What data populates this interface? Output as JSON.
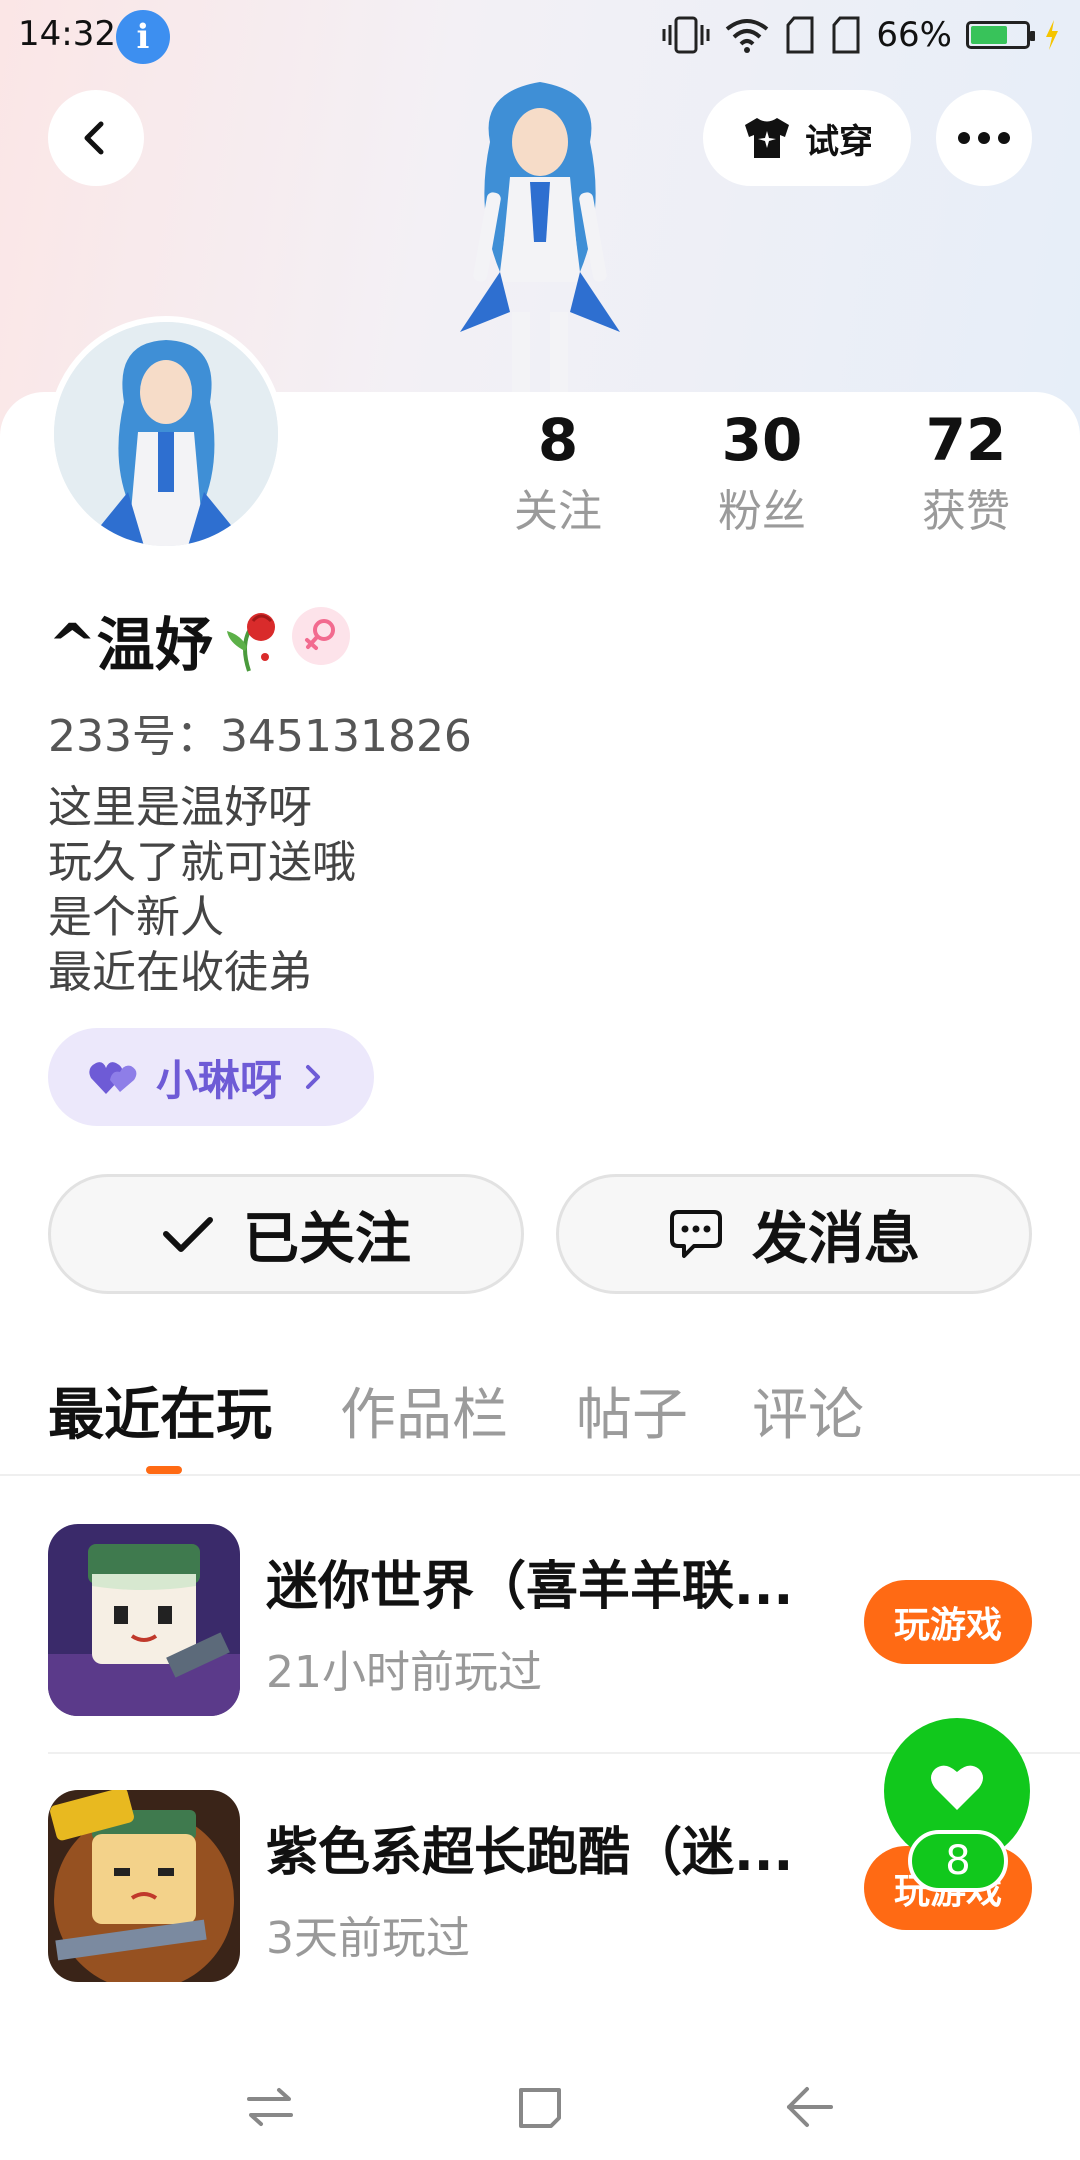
{
  "status_bar": {
    "time": "14:32",
    "battery_percent": "66%",
    "battery_level": 0.66,
    "icons": [
      "info-icon",
      "vibrate-icon",
      "wifi-icon",
      "sim1-icon",
      "sim2-icon",
      "battery-icon",
      "charging-icon"
    ]
  },
  "header": {
    "back_icon": "chevron-left-icon",
    "try_on_label": "试穿",
    "more_icon": "more-dots-icon"
  },
  "profile": {
    "stats": [
      {
        "value": "8",
        "label": "关注"
      },
      {
        "value": "30",
        "label": "粉丝"
      },
      {
        "value": "72",
        "label": "获赞"
      }
    ],
    "nickname": "^温妤",
    "gender": "female",
    "uid_text": "233号：345131826",
    "bio_lines": [
      "这里是温妤呀",
      "玩久了就可送哦",
      "是个新人",
      "最近在收徒弟"
    ],
    "guild_name": "小琳呀"
  },
  "actions": {
    "follow_label": "已关注",
    "message_label": "发消息"
  },
  "tabs": [
    {
      "label": "最近在玩",
      "active": true
    },
    {
      "label": "作品栏",
      "active": false
    },
    {
      "label": "帖子",
      "active": false
    },
    {
      "label": "评论",
      "active": false
    }
  ],
  "games": [
    {
      "title": "迷你世界（喜羊羊联...",
      "time": "21小时前玩过",
      "button": "玩游戏"
    },
    {
      "title": "紫色系超长跑酷（迷...",
      "time": "3天前玩过",
      "button": "玩游戏"
    }
  ],
  "like_fab": {
    "count": "8"
  },
  "colors": {
    "accent": "#ff6a14",
    "guild": "#6e5bd6",
    "like": "#11c81c"
  }
}
